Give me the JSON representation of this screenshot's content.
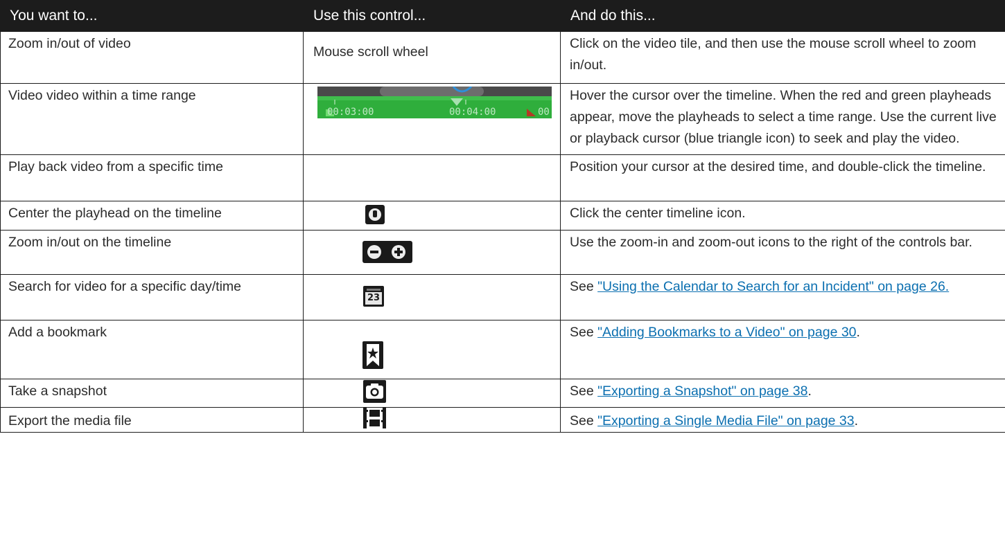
{
  "headers": [
    "You want to...",
    "Use this control...",
    "And do this..."
  ],
  "rows": [
    {
      "want": "Zoom in/out of video",
      "control": "Mouse scroll wheel",
      "action": "Click on the video tile, and then use the mouse scroll wheel to zoom in/out."
    },
    {
      "want": "Video video within a time range",
      "control_icon": "timeline-strip-icon",
      "timeline_labels": [
        "00:03:00",
        "00:04:00",
        "00"
      ],
      "action": "Hover the cursor over the timeline. When the red and green playheads appear, move the playheads to select a time range. Use the current live or playback cursor (blue triangle icon) to seek and play the video."
    },
    {
      "want": "Play back video from a specific time",
      "action": "Position your cursor at the desired time, and double-click the timeline."
    },
    {
      "want": "Center the playhead on the timeline",
      "control_icon": "center-timeline-icon",
      "action": "Click the center timeline icon."
    },
    {
      "want": "Zoom in/out on the timeline",
      "control_icons": [
        "zoom-out-icon",
        "zoom-in-icon"
      ],
      "action": "Use the zoom-in and zoom-out icons to the right of the controls bar."
    },
    {
      "want": "Search for video for a specific day/time",
      "control_icon": "calendar-icon",
      "calendar_day": "23",
      "action_prefix": "See ",
      "link": "\"Using the Calendar to Search for an Incident\" on page 26.",
      "action_suffix": ""
    },
    {
      "want": "Add a bookmark",
      "control_icon": "bookmark-icon",
      "action_prefix": "See ",
      "link": "\"Adding Bookmarks to a Video\" on page 30",
      "action_suffix": "."
    },
    {
      "want": "Take a snapshot",
      "control_icon": "camera-icon",
      "action_prefix": "See ",
      "link": "\"Exporting a Snapshot\" on page 38",
      "action_suffix": "."
    },
    {
      "want": "Export the media file",
      "control_icon": "film-icon",
      "action_prefix": "See ",
      "link": "\"Exporting a Single Media File\" on page 33",
      "action_suffix": "."
    }
  ],
  "colors": {
    "header_bg": "#1c1c1c",
    "link": "#0b6fb0",
    "timeline_green": "#2fae3c",
    "playhead_blue": "#2f8fd8"
  }
}
